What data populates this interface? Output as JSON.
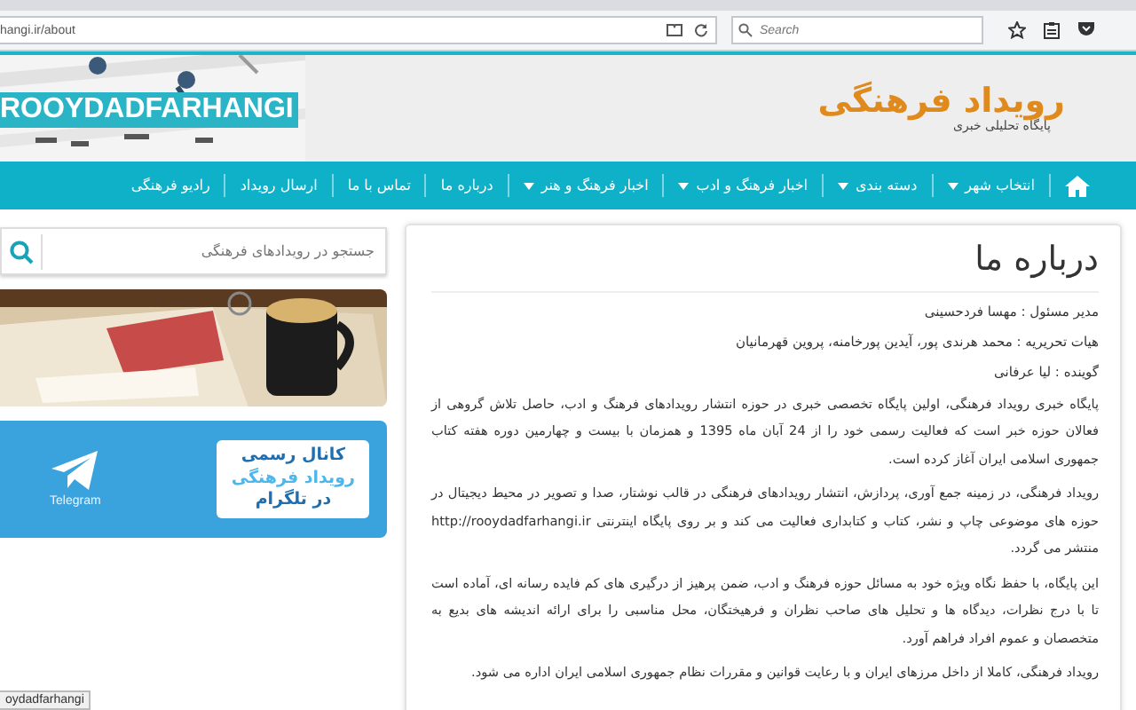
{
  "browser": {
    "url": "hangi.ir/about",
    "search": {
      "placeholder": "Search"
    }
  },
  "header": {
    "banner_label": "ROOYDADFARHANGI",
    "logo": {
      "title": "رویداد فرهنگی",
      "subtitle": "پایگاه تحلیلی خبری"
    }
  },
  "nav": [
    {
      "label": "انتخاب شهر",
      "dropdown": true
    },
    {
      "label": "دسته بندی",
      "dropdown": true
    },
    {
      "label": "اخبار فرهنگ و ادب",
      "dropdown": true
    },
    {
      "label": "اخبار فرهنگ و هنر",
      "dropdown": true
    },
    {
      "label": "درباره ما",
      "dropdown": false
    },
    {
      "label": "تماس با ما",
      "dropdown": false
    },
    {
      "label": "ارسال رویداد",
      "dropdown": false
    },
    {
      "label": "رادیو فرهنگی",
      "dropdown": false
    }
  ],
  "sidebar": {
    "search": {
      "placeholder": "جستجو در رویدادهای فرهنگی"
    },
    "ads": [
      {
        "kind": "picture"
      },
      {
        "kind": "telegram",
        "lines": [
          "کانال رسمی",
          "رویداد فرهنگی",
          "در تلگرام"
        ],
        "caption": "Telegram"
      }
    ]
  },
  "article": {
    "title": "درباره ما",
    "credits": [
      "مدیر مسئول : مهسا فردحسینی",
      "هیات تحریریه : محمد هرندی پور، آیدین پورخامنه، پروین قهرمانیان",
      "گوینده : لیا عرفانی"
    ],
    "paragraphs": [
      "پایگاه خبری رویداد فرهنگی، اولین پایگاه تخصصی خبری در حوزه انتشار رویدادهای فرهنگ و ادب، حاصل تلاش گروهی از فعالان حوزه خبر است که فعالیت رسمی خود را از 24 آبان ماه 1395 و همزمان با بیست و چهارمین دوره هفته کتاب جمهوری اسلامی ایران آغاز کرده است.",
      "رویداد فرهنگی، در زمینه جمع آوری، پردازش، انتشار رویدادهای فرهنگی در قالب نوشتار، صدا و تصویر در محیط دیجیتال در حوزه های موضوعی چاپ و نشر، کتاب و کتابداری فعالیت می کند و بر روی پایگاه اینترنتی http://rooydadfarhangi.ir منتشر می گردد.",
      "این پایگاه، با حفظ نگاه ویژه خود به مسائل حوزه فرهنگ و ادب، ضمن پرهیز از درگیری های کم فایده رسانه ای، آماده است تا با درج نظرات، دیدگاه ها و تحلیل های صاحب نظران و فرهیختگان، محل مناسبی را برای ارائه اندیشه های بدیع به متخصصان و عموم افراد فراهم آورد.",
      "رویداد فرهنگی، کاملا از داخل مرزهای ایران و با رعایت قوانین و مقررات نظام جمهوری اسلامی ایران اداره می شود."
    ]
  },
  "status_bar": {
    "text": "oydadfarhangi"
  }
}
